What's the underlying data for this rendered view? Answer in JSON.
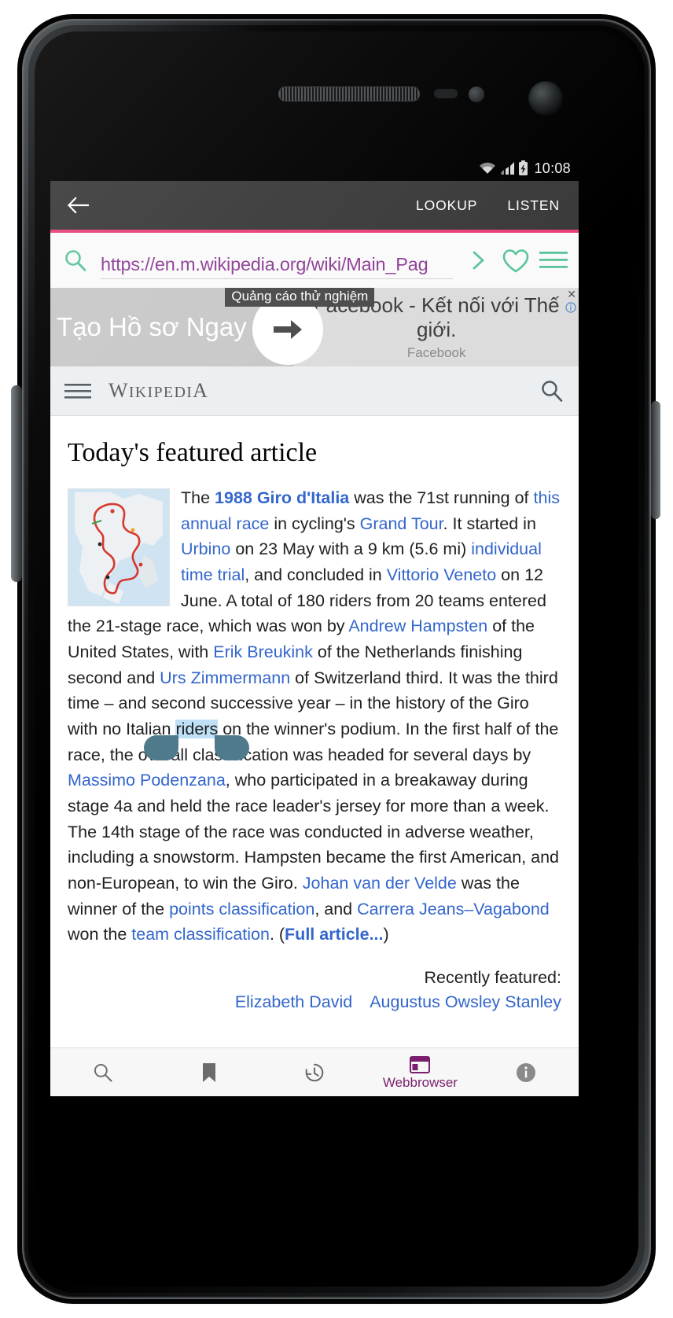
{
  "status_bar": {
    "time": "10:08",
    "icons": [
      "wifi-icon",
      "signal-icon",
      "battery-charging-icon"
    ]
  },
  "action_bar": {
    "back_icon": "back-arrow-icon",
    "lookup_label": "LOOKUP",
    "listen_label": "LISTEN"
  },
  "browser": {
    "search_icon": "search-icon",
    "url": "https://en.m.wikipedia.org/wiki/Main_Pag",
    "go_icon": "chevron-right-icon",
    "favorite_icon": "heart-icon",
    "menu_icon": "hamburger-menu-icon",
    "accent_color": "#59c49a",
    "url_color": "#8e3f96",
    "divider_color": "#e8407a"
  },
  "ad": {
    "left_text": "Tạo Hồ sơ Ngay",
    "tooltip": "Quảng cáo thử nghiệm",
    "arrow_icon": "arrow-right-icon",
    "title": "Facebook - Kết nối với Thế giới.",
    "advertiser": "Facebook",
    "close_label": "✕",
    "info_icon": "ad-info-icon"
  },
  "wiki_header": {
    "menu_icon": "hamburger-menu-icon",
    "logo_first": "W",
    "logo_rest_1": "IKIPEDI",
    "logo_last": "A",
    "search_icon": "search-icon"
  },
  "article": {
    "heading": "Today's featured article",
    "thumbnail_alt": "map-of-italy-route",
    "segments": [
      {
        "t": "The ",
        "k": "text"
      },
      {
        "t": "1988 Giro d'Italia",
        "k": "link-bold"
      },
      {
        "t": " was the 71st running of ",
        "k": "text"
      },
      {
        "t": "this annual race",
        "k": "link"
      },
      {
        "t": " in cycling's ",
        "k": "text"
      },
      {
        "t": "Grand Tour",
        "k": "link"
      },
      {
        "t": ". It started in ",
        "k": "text"
      },
      {
        "t": "Urbino",
        "k": "link"
      },
      {
        "t": " on 23 May with a 9 km (5.6 mi) ",
        "k": "text"
      },
      {
        "t": "individual time trial",
        "k": "link"
      },
      {
        "t": ", and concluded in ",
        "k": "text"
      },
      {
        "t": "Vittorio Veneto",
        "k": "link"
      },
      {
        "t": " on 12 June. A total of 180 riders from 20 teams entered the 21-stage race, which was won by ",
        "k": "text"
      },
      {
        "t": "Andrew Hampsten",
        "k": "link"
      },
      {
        "t": " of the United States, with ",
        "k": "text"
      },
      {
        "t": "Erik Breukink",
        "k": "link"
      },
      {
        "t": " of the Netherlands finishing second and ",
        "k": "text"
      },
      {
        "t": "Urs Zimmermann",
        "k": "link"
      },
      {
        "t": " of Switzerland third. It was the third time – and second successive year – in the history of the Giro with no Italian ",
        "k": "text"
      },
      {
        "t": "riders",
        "k": "selected"
      },
      {
        "t": " on the winner's podium. In the first half of the race, the overall classification was headed for several days by ",
        "k": "text"
      },
      {
        "t": "Massimo Podenzana",
        "k": "link"
      },
      {
        "t": ", who participated in a breakaway during stage 4a and held the race leader's jersey for more than a week. The 14th stage of the race was conducted in adverse weather, including a snowstorm. Hampsten became the first American, and non-European, to win the Giro. ",
        "k": "text"
      },
      {
        "t": "Johan van der Velde",
        "k": "link"
      },
      {
        "t": " was the winner of the ",
        "k": "text"
      },
      {
        "t": "points classification",
        "k": "link"
      },
      {
        "t": ", and ",
        "k": "text"
      },
      {
        "t": "Carrera Jeans–Vagabond",
        "k": "link"
      },
      {
        "t": " won the ",
        "k": "text"
      },
      {
        "t": "team classification",
        "k": "link"
      },
      {
        "t": ". (",
        "k": "text"
      },
      {
        "t": "Full article...",
        "k": "link-bold"
      },
      {
        "t": ")",
        "k": "text"
      }
    ],
    "selected_word": "riders",
    "recently_featured_label": "Recently featured:",
    "recently_featured": [
      "Elizabeth David",
      "Augustus Owsley Stanley"
    ],
    "link_color": "#3366cc",
    "selection_color": "#bfe0f5",
    "handle_color": "#4e7a8c"
  },
  "bottom_nav": {
    "items": [
      {
        "icon": "search-icon",
        "label": ""
      },
      {
        "icon": "bookmark-icon",
        "label": ""
      },
      {
        "icon": "history-icon",
        "label": ""
      },
      {
        "icon": "webbrowser-icon",
        "label": "Webbrowser"
      },
      {
        "icon": "info-icon",
        "label": ""
      }
    ],
    "active_color": "#7a1f6e"
  }
}
